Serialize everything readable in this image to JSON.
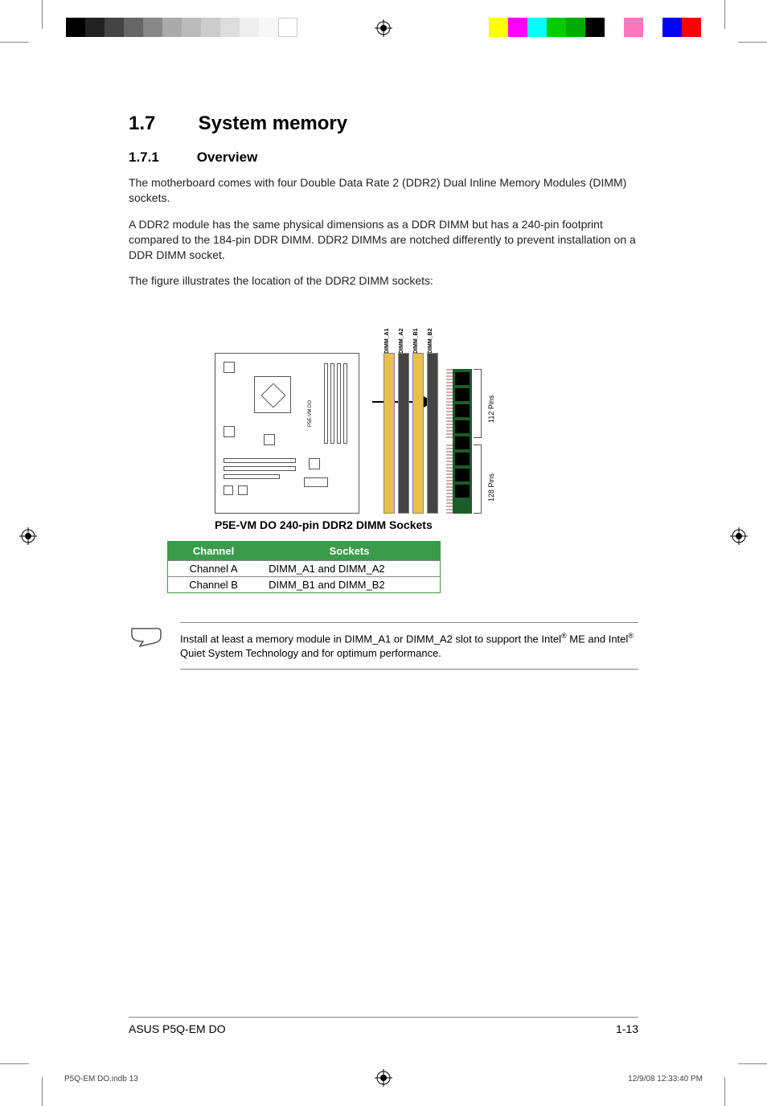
{
  "heading": {
    "number": "1.7",
    "title": "System memory"
  },
  "subheading": {
    "number": "1.7.1",
    "title": "Overview"
  },
  "paragraphs": {
    "p1": "The motherboard comes with four Double Data Rate 2 (DDR2) Dual Inline Memory Modules (DIMM) sockets.",
    "p2": "A DDR2 module has the same physical dimensions as a DDR DIMM but has a 240-pin footprint compared to the 184-pin DDR DIMM. DDR2 DIMMs are notched differently to prevent installation on a DDR DIMM socket.",
    "p3": "The figure illustrates the location of the DDR2 DIMM sockets:"
  },
  "figure": {
    "board_label": "P5E-VM DO",
    "dimm_labels": [
      "DIMM_A1",
      "DIMM_A2",
      "DIMM_B1",
      "DIMM_B2"
    ],
    "pin_labels": {
      "top": "112 Pins",
      "bottom": "128 Pins"
    },
    "caption": "P5E-VM DO 240-pin DDR2 DIMM Sockets"
  },
  "table": {
    "headers": {
      "col1": "Channel",
      "col2": "Sockets"
    },
    "rows": [
      {
        "channel": "Channel A",
        "sockets": "DIMM_A1 and DIMM_A2"
      },
      {
        "channel": "Channel B",
        "sockets": "DIMM_B1 and DIMM_B2"
      }
    ]
  },
  "note": {
    "text_pre": "Install at least a memory module in DIMM_A1 or DIMM_A2 slot to support the Intel",
    "text_mid": " ME and Intel",
    "text_post": " Quiet System Technology and for optimum performance."
  },
  "footer": {
    "left": "ASUS P5Q-EM DO",
    "right": "1-13"
  },
  "print_footer": {
    "left": "P5Q-EM DO.indb   13",
    "right": "12/9/08   12:33:40 PM"
  }
}
